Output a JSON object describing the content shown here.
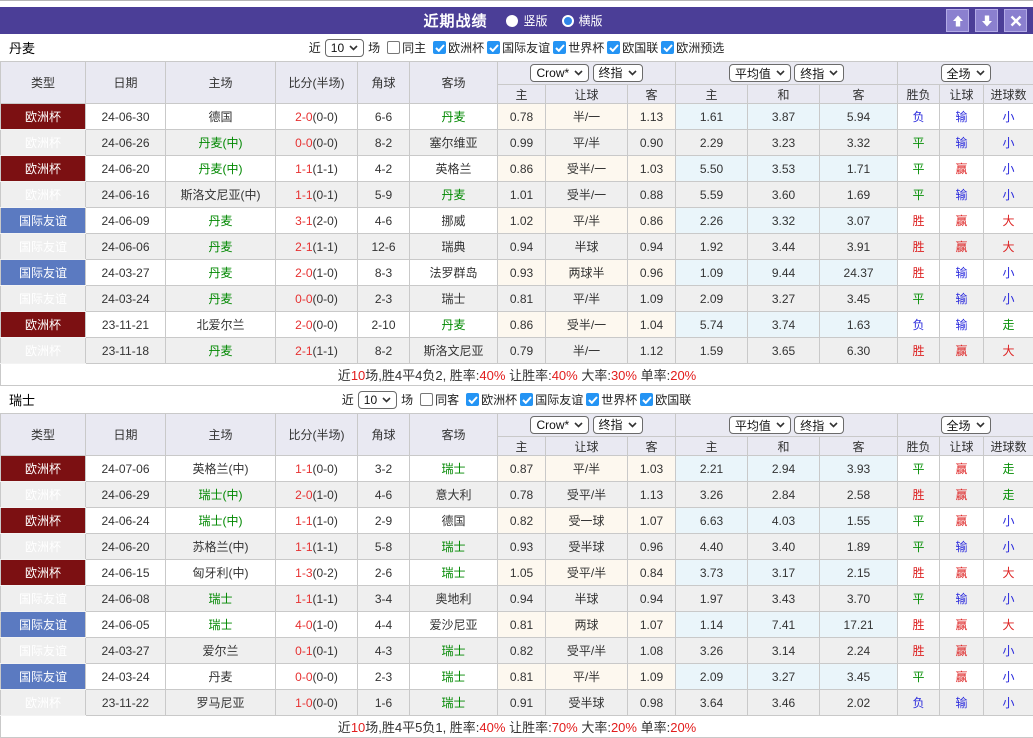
{
  "window": {
    "title": "近期战绩",
    "radios": [
      {
        "label": "竖版",
        "selected": false
      },
      {
        "label": "横版",
        "selected": true
      }
    ]
  },
  "colors": {
    "titlebar": "#4b3e97",
    "titlebar_button": "#8b80cf",
    "euro_badge": "#7c1012",
    "friendly_badge": "#5b7ac1",
    "win": "#dd2222",
    "draw": "#089008",
    "lose": "#2b2bdd",
    "score": "#e63030",
    "green_team": "#008800",
    "handicap_bg": "#fdf8ef",
    "average_bg": "#eaf5fa",
    "checkbox": "#2494f4",
    "header_bg": "#e9e9f2",
    "alt_row": "#efefef"
  },
  "table_header": {
    "left_cols": [
      "类型",
      "日期",
      "主场",
      "比分(半场)",
      "角球",
      "客场"
    ],
    "bookmaker_select": "Crow*",
    "final_select": "终指",
    "average_select": "平均值",
    "final_select2": "终指",
    "scope_select": "全场",
    "odds_cols": [
      "主",
      "让球",
      "客"
    ],
    "avg_cols": [
      "主",
      "和",
      "客"
    ],
    "result_cols": [
      "胜负",
      "让球",
      "进球数"
    ]
  },
  "sections": [
    {
      "team": "丹麦",
      "filter": {
        "prefix": "近",
        "count": "10",
        "suffix": "场",
        "same": {
          "label": "同主",
          "checked": false
        },
        "competitions": [
          {
            "label": "欧洲杯",
            "checked": true
          },
          {
            "label": "国际友谊",
            "checked": true
          },
          {
            "label": "世界杯",
            "checked": true
          },
          {
            "label": "欧国联",
            "checked": true
          },
          {
            "label": "欧洲预选",
            "checked": true
          }
        ]
      },
      "rows": [
        {
          "comp": "euro",
          "type": "欧洲杯",
          "date": "24-06-30",
          "home": "德国",
          "home_green": false,
          "score": "2-0",
          "half": "(0-0)",
          "corners": "6-6",
          "away": "丹麦",
          "away_green": true,
          "handicap_home": "0.78",
          "handicap_line": "半/一",
          "handicap_away": "1.13",
          "avg_home": "1.61",
          "avg_draw": "3.87",
          "avg_away": "5.94",
          "result_outcome": "负",
          "result_outcome_color": "lose",
          "result_handicap": "输",
          "result_handicap_color": "lose",
          "result_goals": "小",
          "result_goals_color": "lose"
        },
        {
          "comp": "euro",
          "type": "欧洲杯",
          "date": "24-06-26",
          "home": "丹麦(中)",
          "home_green": true,
          "score": "0-0",
          "half": "(0-0)",
          "corners": "8-2",
          "away": "塞尔维亚",
          "away_green": false,
          "handicap_home": "0.99",
          "handicap_line": "平/半",
          "handicap_away": "0.90",
          "avg_home": "2.29",
          "avg_draw": "3.23",
          "avg_away": "3.32",
          "result_outcome": "平",
          "result_outcome_color": "draw",
          "result_handicap": "输",
          "result_handicap_color": "lose",
          "result_goals": "小",
          "result_goals_color": "lose"
        },
        {
          "comp": "euro",
          "type": "欧洲杯",
          "date": "24-06-20",
          "home": "丹麦(中)",
          "home_green": true,
          "score": "1-1",
          "half": "(1-1)",
          "corners": "4-2",
          "away": "英格兰",
          "away_green": false,
          "handicap_home": "0.86",
          "handicap_line": "受半/一",
          "handicap_away": "1.03",
          "avg_home": "5.50",
          "avg_draw": "3.53",
          "avg_away": "1.71",
          "result_outcome": "平",
          "result_outcome_color": "draw",
          "result_handicap": "赢",
          "result_handicap_color": "win",
          "result_goals": "小",
          "result_goals_color": "lose"
        },
        {
          "comp": "euro",
          "type": "欧洲杯",
          "date": "24-06-16",
          "home": "斯洛文尼亚(中)",
          "home_green": false,
          "score": "1-1",
          "half": "(0-1)",
          "corners": "5-9",
          "away": "丹麦",
          "away_green": true,
          "handicap_home": "1.01",
          "handicap_line": "受半/一",
          "handicap_away": "0.88",
          "avg_home": "5.59",
          "avg_draw": "3.60",
          "avg_away": "1.69",
          "result_outcome": "平",
          "result_outcome_color": "draw",
          "result_handicap": "输",
          "result_handicap_color": "lose",
          "result_goals": "小",
          "result_goals_color": "lose"
        },
        {
          "comp": "friendly",
          "type": "国际友谊",
          "date": "24-06-09",
          "home": "丹麦",
          "home_green": true,
          "score": "3-1",
          "half": "(2-0)",
          "corners": "4-6",
          "away": "挪威",
          "away_green": false,
          "handicap_home": "1.02",
          "handicap_line": "平/半",
          "handicap_away": "0.86",
          "avg_home": "2.26",
          "avg_draw": "3.32",
          "avg_away": "3.07",
          "result_outcome": "胜",
          "result_outcome_color": "win",
          "result_handicap": "赢",
          "result_handicap_color": "win",
          "result_goals": "大",
          "result_goals_color": "win"
        },
        {
          "comp": "friendly",
          "type": "国际友谊",
          "date": "24-06-06",
          "home": "丹麦",
          "home_green": true,
          "score": "2-1",
          "half": "(1-1)",
          "corners": "12-6",
          "away": "瑞典",
          "away_green": false,
          "handicap_home": "0.94",
          "handicap_line": "半球",
          "handicap_away": "0.94",
          "avg_home": "1.92",
          "avg_draw": "3.44",
          "avg_away": "3.91",
          "result_outcome": "胜",
          "result_outcome_color": "win",
          "result_handicap": "赢",
          "result_handicap_color": "win",
          "result_goals": "大",
          "result_goals_color": "win"
        },
        {
          "comp": "friendly",
          "type": "国际友谊",
          "date": "24-03-27",
          "home": "丹麦",
          "home_green": true,
          "score": "2-0",
          "half": "(1-0)",
          "corners": "8-3",
          "away": "法罗群岛",
          "away_green": false,
          "handicap_home": "0.93",
          "handicap_line": "两球半",
          "handicap_away": "0.96",
          "avg_home": "1.09",
          "avg_draw": "9.44",
          "avg_away": "24.37",
          "result_outcome": "胜",
          "result_outcome_color": "win",
          "result_handicap": "输",
          "result_handicap_color": "lose",
          "result_goals": "小",
          "result_goals_color": "lose"
        },
        {
          "comp": "friendly",
          "type": "国际友谊",
          "date": "24-03-24",
          "home": "丹麦",
          "home_green": true,
          "score": "0-0",
          "half": "(0-0)",
          "corners": "2-3",
          "away": "瑞士",
          "away_green": false,
          "handicap_home": "0.81",
          "handicap_line": "平/半",
          "handicap_away": "1.09",
          "avg_home": "2.09",
          "avg_draw": "3.27",
          "avg_away": "3.45",
          "result_outcome": "平",
          "result_outcome_color": "draw",
          "result_handicap": "输",
          "result_handicap_color": "lose",
          "result_goals": "小",
          "result_goals_color": "lose"
        },
        {
          "comp": "euro",
          "type": "欧洲杯",
          "date": "23-11-21",
          "home": "北爱尔兰",
          "home_green": false,
          "score": "2-0",
          "half": "(0-0)",
          "corners": "2-10",
          "away": "丹麦",
          "away_green": true,
          "handicap_home": "0.86",
          "handicap_line": "受半/一",
          "handicap_away": "1.04",
          "avg_home": "5.74",
          "avg_draw": "3.74",
          "avg_away": "1.63",
          "result_outcome": "负",
          "result_outcome_color": "lose",
          "result_handicap": "输",
          "result_handicap_color": "lose",
          "result_goals": "走",
          "result_goals_color": "draw"
        },
        {
          "comp": "euro",
          "type": "欧洲杯",
          "date": "23-11-18",
          "home": "丹麦",
          "home_green": true,
          "score": "2-1",
          "half": "(1-1)",
          "corners": "8-2",
          "away": "斯洛文尼亚",
          "away_green": false,
          "handicap_home": "0.79",
          "handicap_line": "半/一",
          "handicap_away": "1.12",
          "avg_home": "1.59",
          "avg_draw": "3.65",
          "avg_away": "6.30",
          "result_outcome": "胜",
          "result_outcome_color": "win",
          "result_handicap": "赢",
          "result_handicap_color": "win",
          "result_goals": "大",
          "result_goals_color": "win"
        }
      ],
      "summary": [
        {
          "t": "近"
        },
        {
          "t": "10",
          "red": true
        },
        {
          "t": "场,胜4平4负2, 胜率:"
        },
        {
          "t": "40%",
          "red": true
        },
        {
          "t": " 让胜率:"
        },
        {
          "t": "40%",
          "red": true
        },
        {
          "t": " 大率:"
        },
        {
          "t": "30%",
          "red": true
        },
        {
          "t": " 单率:"
        },
        {
          "t": "20%",
          "red": true
        }
      ]
    },
    {
      "team": "瑞士",
      "filter": {
        "prefix": "近",
        "count": "10",
        "suffix": "场",
        "same": {
          "label": "同客",
          "checked": false
        },
        "competitions": [
          {
            "label": "欧洲杯",
            "checked": true
          },
          {
            "label": "国际友谊",
            "checked": true
          },
          {
            "label": "世界杯",
            "checked": true
          },
          {
            "label": "欧国联",
            "checked": true
          }
        ]
      },
      "rows": [
        {
          "comp": "euro",
          "type": "欧洲杯",
          "date": "24-07-06",
          "home": "英格兰(中)",
          "home_green": false,
          "score": "1-1",
          "half": "(0-0)",
          "corners": "3-2",
          "away": "瑞士",
          "away_green": true,
          "handicap_home": "0.87",
          "handicap_line": "平/半",
          "handicap_away": "1.03",
          "avg_home": "2.21",
          "avg_draw": "2.94",
          "avg_away": "3.93",
          "result_outcome": "平",
          "result_outcome_color": "draw",
          "result_handicap": "赢",
          "result_handicap_color": "win",
          "result_goals": "走",
          "result_goals_color": "draw"
        },
        {
          "comp": "euro",
          "type": "欧洲杯",
          "date": "24-06-29",
          "home": "瑞士(中)",
          "home_green": true,
          "score": "2-0",
          "half": "(1-0)",
          "corners": "4-6",
          "away": "意大利",
          "away_green": false,
          "handicap_home": "0.78",
          "handicap_line": "受平/半",
          "handicap_away": "1.13",
          "avg_home": "3.26",
          "avg_draw": "2.84",
          "avg_away": "2.58",
          "result_outcome": "胜",
          "result_outcome_color": "win",
          "result_handicap": "赢",
          "result_handicap_color": "win",
          "result_goals": "走",
          "result_goals_color": "draw"
        },
        {
          "comp": "euro",
          "type": "欧洲杯",
          "date": "24-06-24",
          "home": "瑞士(中)",
          "home_green": true,
          "score": "1-1",
          "half": "(1-0)",
          "corners": "2-9",
          "away": "德国",
          "away_green": false,
          "handicap_home": "0.82",
          "handicap_line": "受一球",
          "handicap_away": "1.07",
          "avg_home": "6.63",
          "avg_draw": "4.03",
          "avg_away": "1.55",
          "result_outcome": "平",
          "result_outcome_color": "draw",
          "result_handicap": "赢",
          "result_handicap_color": "win",
          "result_goals": "小",
          "result_goals_color": "lose"
        },
        {
          "comp": "euro",
          "type": "欧洲杯",
          "date": "24-06-20",
          "home": "苏格兰(中)",
          "home_green": false,
          "score": "1-1",
          "half": "(1-1)",
          "corners": "5-8",
          "away": "瑞士",
          "away_green": true,
          "handicap_home": "0.93",
          "handicap_line": "受半球",
          "handicap_away": "0.96",
          "avg_home": "4.40",
          "avg_draw": "3.40",
          "avg_away": "1.89",
          "result_outcome": "平",
          "result_outcome_color": "draw",
          "result_handicap": "输",
          "result_handicap_color": "lose",
          "result_goals": "小",
          "result_goals_color": "lose"
        },
        {
          "comp": "euro",
          "type": "欧洲杯",
          "date": "24-06-15",
          "home": "匈牙利(中)",
          "home_green": false,
          "score": "1-3",
          "half": "(0-2)",
          "corners": "2-6",
          "away": "瑞士",
          "away_green": true,
          "handicap_home": "1.05",
          "handicap_line": "受平/半",
          "handicap_away": "0.84",
          "avg_home": "3.73",
          "avg_draw": "3.17",
          "avg_away": "2.15",
          "result_outcome": "胜",
          "result_outcome_color": "win",
          "result_handicap": "赢",
          "result_handicap_color": "win",
          "result_goals": "大",
          "result_goals_color": "win"
        },
        {
          "comp": "friendly",
          "type": "国际友谊",
          "date": "24-06-08",
          "home": "瑞士",
          "home_green": true,
          "score": "1-1",
          "half": "(1-1)",
          "corners": "3-4",
          "away": "奥地利",
          "away_green": false,
          "handicap_home": "0.94",
          "handicap_line": "半球",
          "handicap_away": "0.94",
          "avg_home": "1.97",
          "avg_draw": "3.43",
          "avg_away": "3.70",
          "result_outcome": "平",
          "result_outcome_color": "draw",
          "result_handicap": "输",
          "result_handicap_color": "lose",
          "result_goals": "小",
          "result_goals_color": "lose"
        },
        {
          "comp": "friendly",
          "type": "国际友谊",
          "date": "24-06-05",
          "home": "瑞士",
          "home_green": true,
          "score": "4-0",
          "half": "(1-0)",
          "corners": "4-4",
          "away": "爱沙尼亚",
          "away_green": false,
          "handicap_home": "0.81",
          "handicap_line": "两球",
          "handicap_away": "1.07",
          "avg_home": "1.14",
          "avg_draw": "7.41",
          "avg_away": "17.21",
          "result_outcome": "胜",
          "result_outcome_color": "win",
          "result_handicap": "赢",
          "result_handicap_color": "win",
          "result_goals": "大",
          "result_goals_color": "win"
        },
        {
          "comp": "friendly",
          "type": "国际友谊",
          "date": "24-03-27",
          "home": "爱尔兰",
          "home_green": false,
          "score": "0-1",
          "half": "(0-1)",
          "corners": "4-3",
          "away": "瑞士",
          "away_green": true,
          "handicap_home": "0.82",
          "handicap_line": "受平/半",
          "handicap_away": "1.08",
          "avg_home": "3.26",
          "avg_draw": "3.14",
          "avg_away": "2.24",
          "result_outcome": "胜",
          "result_outcome_color": "win",
          "result_handicap": "赢",
          "result_handicap_color": "win",
          "result_goals": "小",
          "result_goals_color": "lose"
        },
        {
          "comp": "friendly",
          "type": "国际友谊",
          "date": "24-03-24",
          "home": "丹麦",
          "home_green": false,
          "score": "0-0",
          "half": "(0-0)",
          "corners": "2-3",
          "away": "瑞士",
          "away_green": true,
          "handicap_home": "0.81",
          "handicap_line": "平/半",
          "handicap_away": "1.09",
          "avg_home": "2.09",
          "avg_draw": "3.27",
          "avg_away": "3.45",
          "result_outcome": "平",
          "result_outcome_color": "draw",
          "result_handicap": "赢",
          "result_handicap_color": "win",
          "result_goals": "小",
          "result_goals_color": "lose"
        },
        {
          "comp": "euro",
          "type": "欧洲杯",
          "date": "23-11-22",
          "home": "罗马尼亚",
          "home_green": false,
          "score": "1-0",
          "half": "(0-0)",
          "corners": "1-6",
          "away": "瑞士",
          "away_green": true,
          "handicap_home": "0.91",
          "handicap_line": "受半球",
          "handicap_away": "0.98",
          "avg_home": "3.64",
          "avg_draw": "3.46",
          "avg_away": "2.02",
          "result_outcome": "负",
          "result_outcome_color": "lose",
          "result_handicap": "输",
          "result_handicap_color": "lose",
          "result_goals": "小",
          "result_goals_color": "lose"
        }
      ],
      "summary": [
        {
          "t": "近"
        },
        {
          "t": "10",
          "red": true
        },
        {
          "t": "场,胜4平5负1, 胜率:"
        },
        {
          "t": "40%",
          "red": true
        },
        {
          "t": " 让胜率:"
        },
        {
          "t": "70%",
          "red": true
        },
        {
          "t": " 大率:"
        },
        {
          "t": "20%",
          "red": true
        },
        {
          "t": " 单率:"
        },
        {
          "t": "20%",
          "red": true
        }
      ]
    }
  ]
}
